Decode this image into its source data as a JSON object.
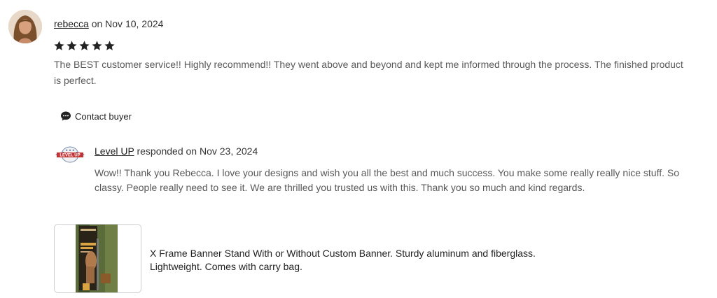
{
  "review": {
    "reviewer_name": "rebecca",
    "date_text": "on Nov 10, 2024",
    "rating": 5,
    "star_color": "#222222",
    "text": "The BEST customer service!! Highly recommend!! They went above and beyond and kept me informed through the process. The finished product is perfect.",
    "contact_label": "Contact buyer",
    "contact_icon": "chat-bubble-icon"
  },
  "response": {
    "shop_name": "Level UP",
    "date_text": "responded on Nov 23, 2024",
    "logo_text": "LEVEL UP",
    "text": "Wow!! Thank you Rebecca. I love your designs and wish you all the best and much success. You make some really really nice stuff. So classy. People really need to see it. We are thrilled you trusted us with this. Thank you so much and kind regards."
  },
  "product": {
    "title": "X Frame Banner Stand With or Without Custom Banner. Sturdy aluminum and fiberglass. Lightweight. Comes with carry bag."
  }
}
